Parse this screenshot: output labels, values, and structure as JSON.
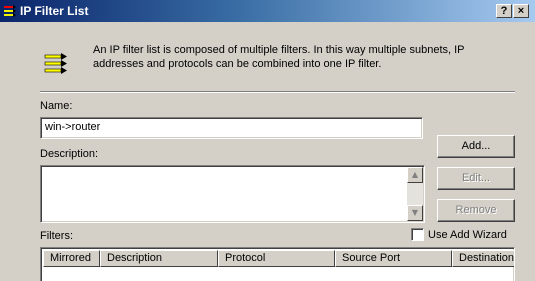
{
  "window": {
    "title": "IP Filter List",
    "help_label": "?",
    "close_label": "×"
  },
  "info": {
    "text": "An IP filter list is composed of multiple filters. In this way multiple subnets, IP addresses and protocols can be combined into one IP filter.",
    "icon": "filter-list-icon"
  },
  "form": {
    "name_label": "Name:",
    "name_value": "win->router",
    "description_label": "Description:",
    "description_value": ""
  },
  "buttons": {
    "add": "Add...",
    "edit": "Edit...",
    "remove": "Remove"
  },
  "filters": {
    "label": "Filters:",
    "use_add_wizard_label": "Use Add Wizard",
    "use_add_wizard_checked": false,
    "columns": [
      "Mirrored",
      "Description",
      "Protocol",
      "Source Port",
      "Destination"
    ]
  },
  "colors": {
    "titlebar_start": "#0a246a",
    "titlebar_end": "#a6caf0",
    "face": "#d4d0c8"
  }
}
